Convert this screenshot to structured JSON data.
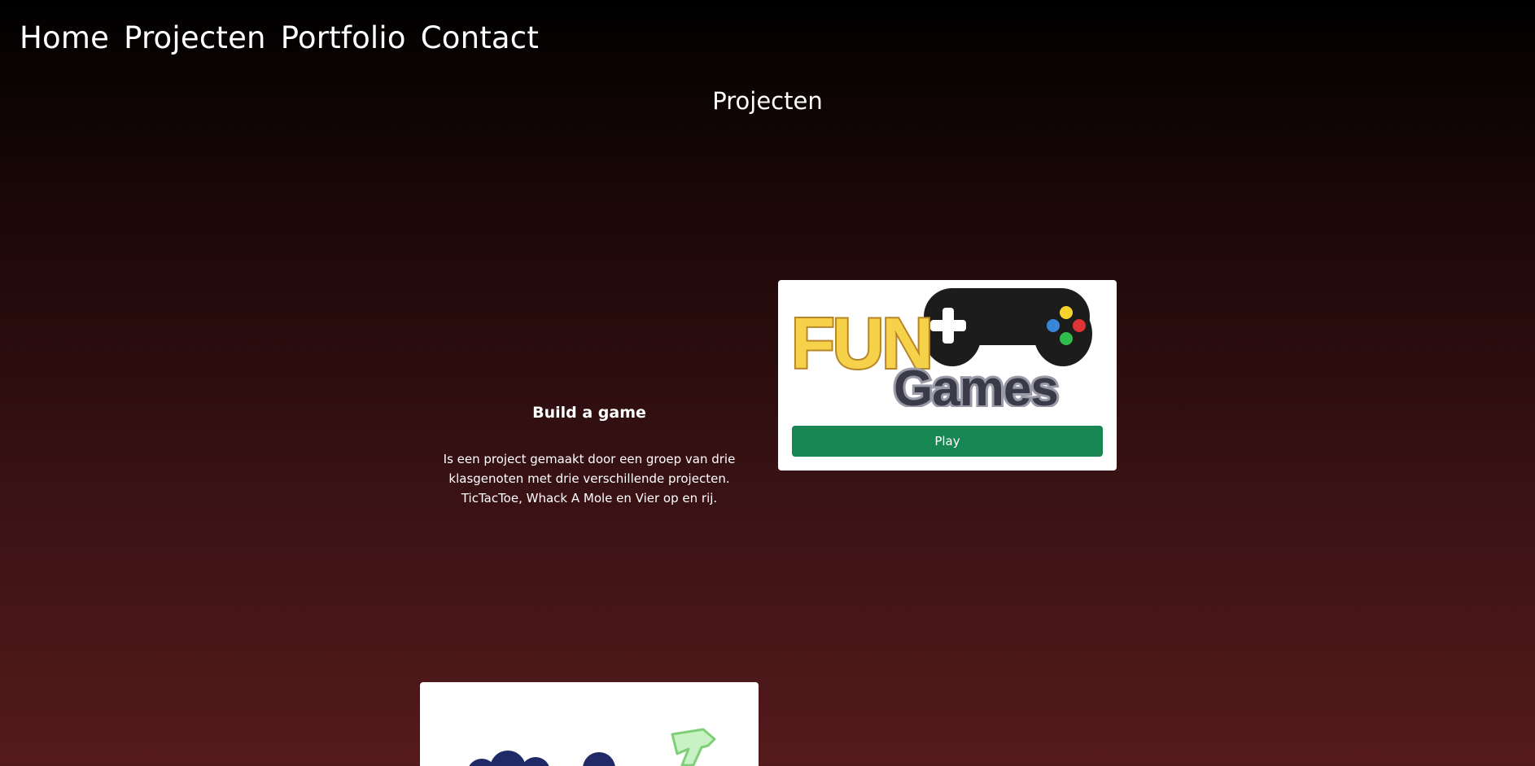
{
  "nav": {
    "items": [
      {
        "label": "Home"
      },
      {
        "label": "Projecten"
      },
      {
        "label": "Portfolio"
      },
      {
        "label": "Contact"
      }
    ]
  },
  "page": {
    "title": "Projecten"
  },
  "project": {
    "heading": "Build a game",
    "description": "Is een project gemaakt door een groep van drie klasgenoten met drie verschillende projecten. TicTacToe, Whack A Mole en Vier op en rij.",
    "logo": {
      "word_fun": "FUN",
      "word_games": "Games",
      "icon": "gamepad-icon"
    },
    "play_label": "Play"
  },
  "colors": {
    "play_button": "#198754",
    "fun_yellow": "#f5d24a",
    "fun_outline": "#b8862a",
    "controller": "#1c1c1c",
    "games_text": "#3a3a48",
    "games_outline": "#9a9aa8",
    "button_blue": "#3a86d6",
    "button_yellow": "#f5d22c",
    "button_red": "#e03434",
    "button_green": "#2ebd4a"
  }
}
